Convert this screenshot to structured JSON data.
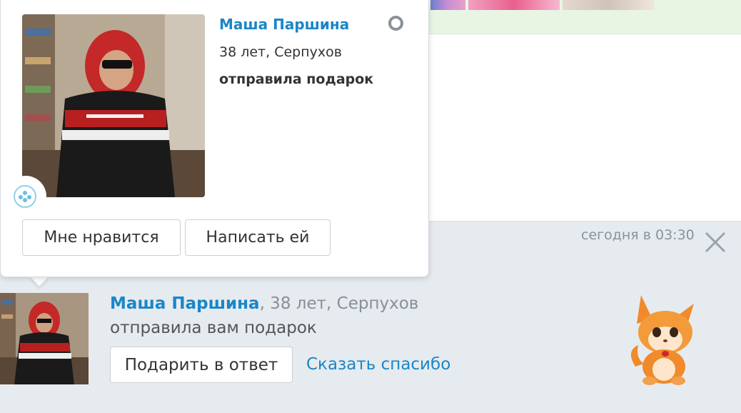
{
  "popup": {
    "name": "Маша Паршина",
    "age_city": "38 лет, Серпухов",
    "action": "отправила подарок",
    "like_button": "Мне нравится",
    "write_button": "Написать ей"
  },
  "notification": {
    "time": "сегодня в 03:30",
    "name": "Маша Паршина",
    "age_city": ", 38 лет, Серпухов",
    "message": "отправила вам подарок",
    "gift_back_button": "Подарить в ответ",
    "thanks_link": "Сказать спасибо"
  },
  "colors": {
    "link": "#1a86c7",
    "page_bg": "#e6ebef",
    "top_strip": "#e8f5e3"
  }
}
